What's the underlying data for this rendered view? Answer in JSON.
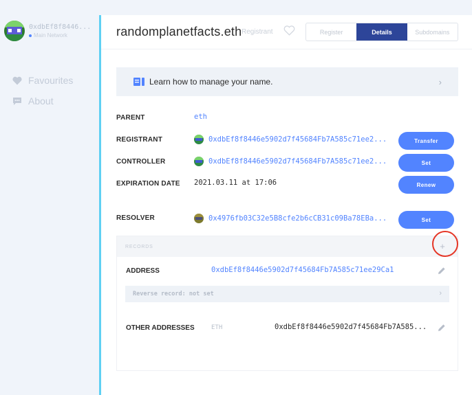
{
  "account": {
    "address": "0xdbEf8f8446...",
    "network": "Main Network"
  },
  "sidebar": {
    "items": [
      {
        "label": "Favourites",
        "icon": "heart-icon"
      },
      {
        "label": "About",
        "icon": "chat-icon"
      }
    ]
  },
  "header": {
    "name": "randomplanetfacts.eth",
    "badge": "Registrant",
    "tabs": [
      {
        "label": "Register"
      },
      {
        "label": "Details"
      },
      {
        "label": "Subdomains"
      }
    ],
    "active_tab": "Details"
  },
  "learn": {
    "text": "Learn how to manage your name."
  },
  "details": {
    "parent": {
      "label": "PARENT",
      "value": "eth"
    },
    "registrant": {
      "label": "REGISTRANT",
      "value": "0xdbEf8f8446e5902d7f45684Fb7A585c71ee2...",
      "button": "Transfer"
    },
    "controller": {
      "label": "CONTROLLER",
      "value": "0xdbEf8f8446e5902d7f45684Fb7A585c71ee2...",
      "button": "Set"
    },
    "expiration": {
      "label": "EXPIRATION DATE",
      "value": "2021.03.11 at 17:06",
      "button": "Renew"
    },
    "resolver": {
      "label": "RESOLVER",
      "value": "0x4976fb03C32e5B8cfe2b6cCB31c09Ba78EBa...",
      "button": "Set"
    }
  },
  "records": {
    "title": "RECORDS",
    "add_symbol": "+",
    "address": {
      "label": "ADDRESS",
      "value": "0xdbEf8f8446e5902d7f45684Fb7A585c71ee29Ca1"
    },
    "reverse": {
      "text": "Reverse record: not set"
    },
    "other": {
      "label": "OTHER ADDRESSES",
      "coin": "ETH",
      "value": "0xdbEf8f8446e5902d7f45684Fb7A585..."
    }
  },
  "colors": {
    "accent": "#5284ff",
    "tab_active": "#2d4599",
    "sidebar_accent": "#5fd0f3",
    "highlight_circle": "#e53525"
  }
}
